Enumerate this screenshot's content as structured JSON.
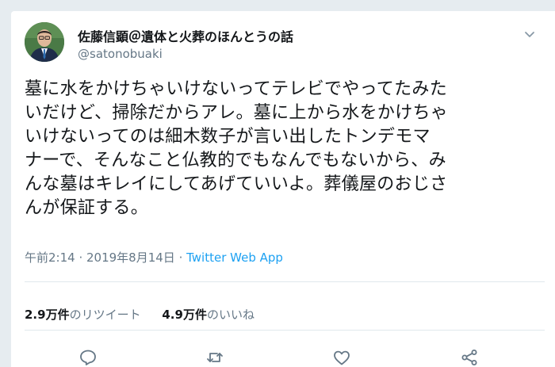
{
  "tweet": {
    "author_name": "佐藤信顕＠遺体と火葬のほんとうの話",
    "author_handle": "@satonobuaki",
    "text_lines": [
      "墓に水をかけちゃいけないってテレビでやってたみた",
      "いだけど、掃除だからアレ。墓に上から水をかけちゃ",
      "いけないってのは細木数子が言い出したトンデモマ",
      "ナーで、そんなこと仏教的でもなんでもないから、み",
      "んな墓はキレイにしてあげていいよ。葬儀屋のおじさ",
      "んが保証する。"
    ],
    "timestamp": "午前2:14 · 2019年8月14日",
    "separator": " · ",
    "source": "Twitter Web App"
  },
  "stats": {
    "retweets_count": "2.9万件",
    "retweets_label": "のリツイート",
    "likes_count": "4.9万件",
    "likes_label": "のいいね"
  },
  "icons": {
    "menu": "chevron-down-icon",
    "reply": "reply-icon",
    "retweet": "retweet-icon",
    "like": "heart-icon",
    "share": "share-icon"
  },
  "colors": {
    "text": "#14171a",
    "secondary": "#657786",
    "link": "#1da1f2",
    "border": "#e1e8ed"
  }
}
